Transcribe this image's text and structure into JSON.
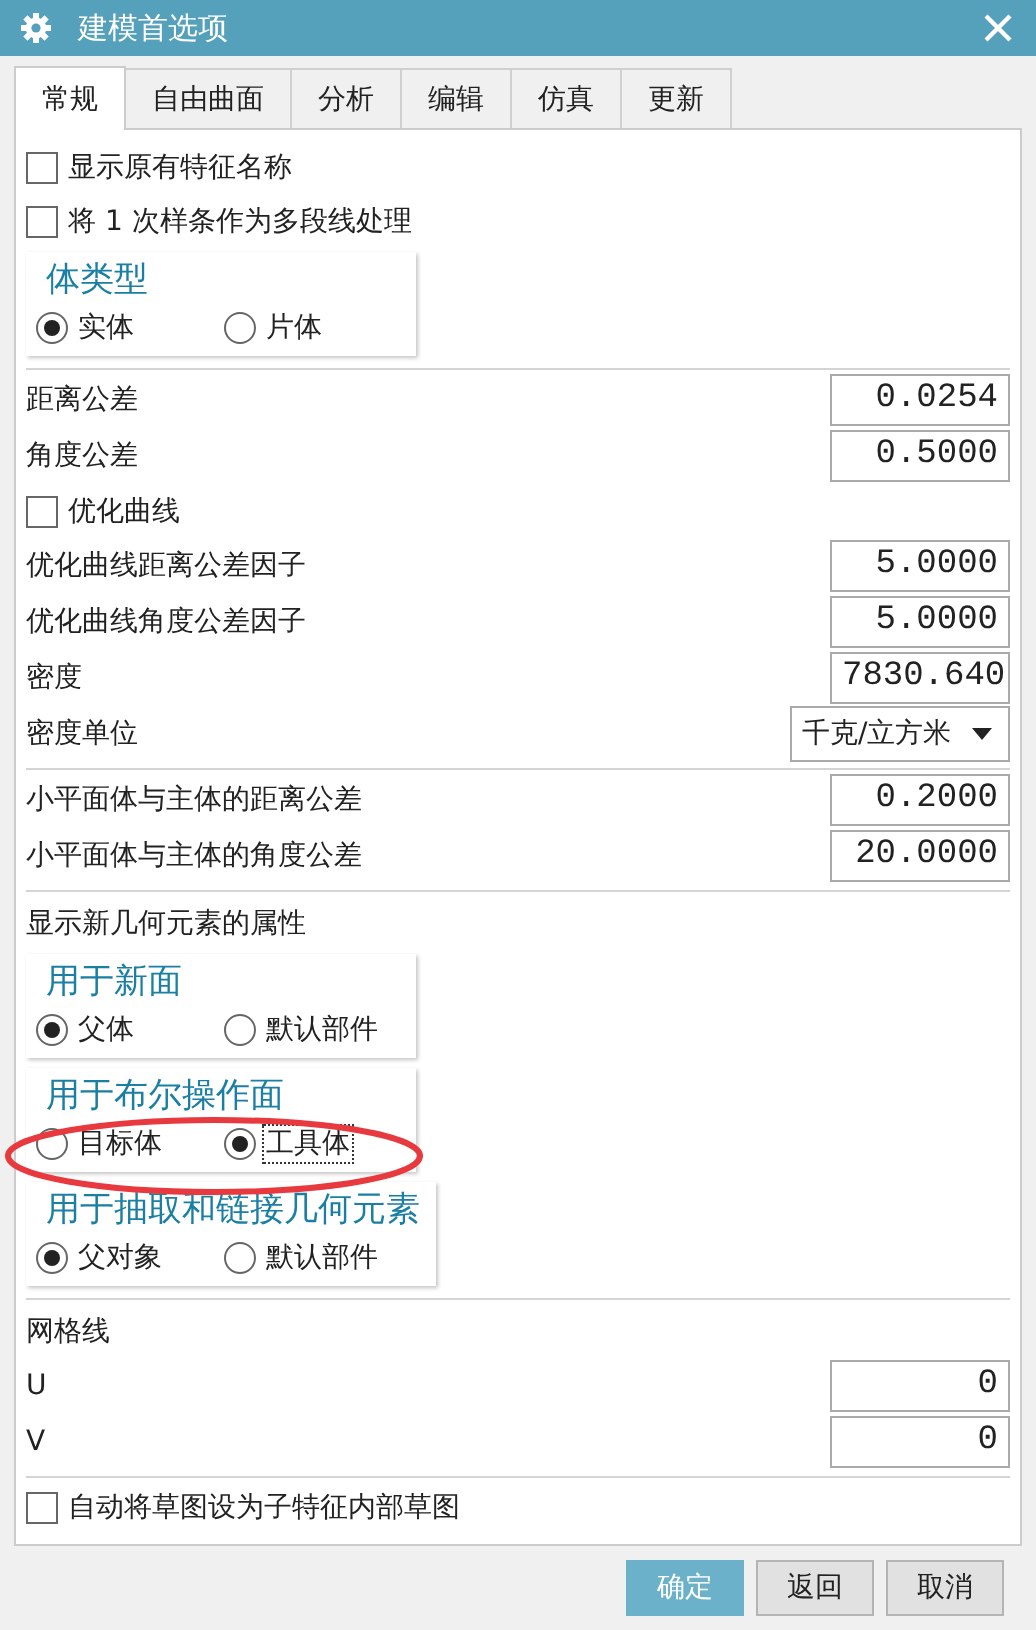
{
  "window": {
    "title": "建模首选项"
  },
  "tabs": [
    {
      "label": "常规",
      "selected": true
    },
    {
      "label": "自由曲面",
      "selected": false
    },
    {
      "label": "分析",
      "selected": false
    },
    {
      "label": "编辑",
      "selected": false
    },
    {
      "label": "仿真",
      "selected": false
    },
    {
      "label": "更新",
      "selected": false
    }
  ],
  "sections": [
    [
      {
        "kind": "checkbox",
        "label": "显示原有特征名称",
        "checked": false
      },
      {
        "kind": "checkbox",
        "label": "将 1 次样条作为多段线处理",
        "checked": false
      },
      {
        "kind": "radio_group",
        "title": "体类型",
        "highlighted": false,
        "options": [
          {
            "label": "实体",
            "selected": true,
            "focused": false
          },
          {
            "label": "片体",
            "selected": false,
            "focused": false
          }
        ]
      }
    ],
    [
      {
        "kind": "number",
        "label": "距离公差",
        "value": "0.0254"
      },
      {
        "kind": "number",
        "label": "角度公差",
        "value": "0.5000"
      },
      {
        "kind": "checkbox",
        "label": "优化曲线",
        "checked": false
      },
      {
        "kind": "number",
        "label": "优化曲线距离公差因子",
        "value": "5.0000"
      },
      {
        "kind": "number",
        "label": "优化曲线角度公差因子",
        "value": "5.0000"
      },
      {
        "kind": "number",
        "label": "密度",
        "value": "7830.640"
      },
      {
        "kind": "dropdown",
        "label": "密度单位",
        "value": "千克/立方米"
      }
    ],
    [
      {
        "kind": "number",
        "label": "小平面体与主体的距离公差",
        "value": "0.2000"
      },
      {
        "kind": "number",
        "label": "小平面体与主体的角度公差",
        "value": "20.0000"
      }
    ],
    [
      {
        "kind": "heading",
        "label": "显示新几何元素的属性"
      },
      {
        "kind": "radio_group",
        "title": "用于新面",
        "highlighted": false,
        "options": [
          {
            "label": "父体",
            "selected": true,
            "focused": false
          },
          {
            "label": "默认部件",
            "selected": false,
            "focused": false
          }
        ]
      },
      {
        "kind": "radio_group",
        "title": "用于布尔操作面",
        "highlighted": true,
        "options": [
          {
            "label": "目标体",
            "selected": false,
            "focused": false
          },
          {
            "label": "工具体",
            "selected": true,
            "focused": true
          }
        ]
      },
      {
        "kind": "radio_group",
        "title": "用于抽取和链接几何元素",
        "highlighted": false,
        "options": [
          {
            "label": "父对象",
            "selected": true,
            "focused": false
          },
          {
            "label": "默认部件",
            "selected": false,
            "focused": false
          }
        ]
      }
    ],
    [
      {
        "kind": "heading",
        "label": "网格线"
      },
      {
        "kind": "number",
        "label": "U",
        "value": "0"
      },
      {
        "kind": "number",
        "label": "V",
        "value": "0"
      }
    ],
    [
      {
        "kind": "checkbox",
        "label": "自动将草图设为子特征内部草图",
        "checked": false
      }
    ]
  ],
  "buttons": [
    {
      "label": "确定",
      "primary": true
    },
    {
      "label": "返回",
      "primary": false
    },
    {
      "label": "取消",
      "primary": false
    }
  ]
}
